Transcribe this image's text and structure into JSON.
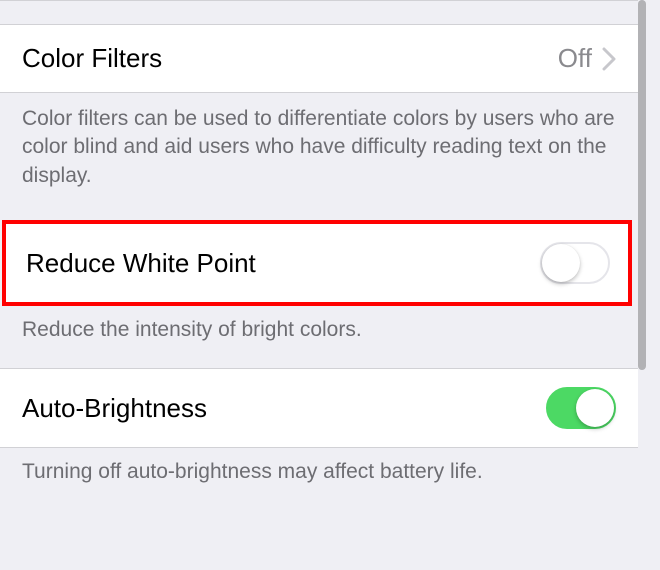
{
  "rows": {
    "color_filters": {
      "label": "Color Filters",
      "value": "Off",
      "footer": "Color filters can be used to differentiate colors by users who are color blind and aid users who have difficulty reading text on the display."
    },
    "reduce_white_point": {
      "label": "Reduce White Point",
      "state": "off",
      "footer": "Reduce the intensity of bright colors."
    },
    "auto_brightness": {
      "label": "Auto-Brightness",
      "state": "on",
      "footer": "Turning off auto-brightness may affect battery life."
    }
  }
}
